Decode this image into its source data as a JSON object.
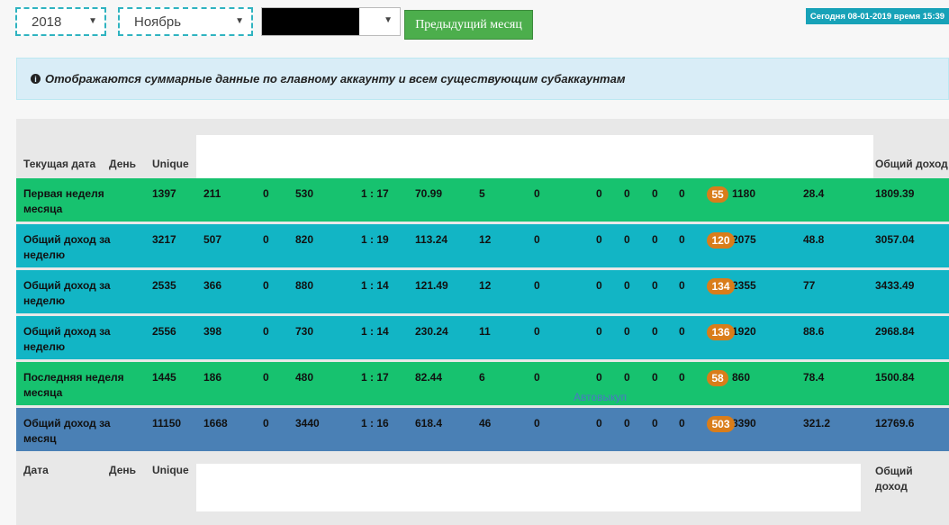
{
  "filters": {
    "year": "2018",
    "month": "Ноябрь",
    "account": ""
  },
  "prev_month_button": "Предыдущий месяц",
  "today": "Сегодня 08-01-2019 время 15:39",
  "notice": "Отображаются суммарные данные по главному аккаунту и всем существующим субаккаунтам",
  "table": {
    "header": {
      "date": "Текущая дата",
      "day": "День",
      "unique": "Unique",
      "total": "Общий доход"
    },
    "rows": [
      {
        "label": "Первая неделя месяца",
        "unique": "1397",
        "c1": "211",
        "c2": "0",
        "c3": "530",
        "ratio": "1 : 17",
        "c5": "70.99",
        "c6": "5",
        "c7": "0",
        "c8": "0",
        "c9": "0",
        "c10": "0",
        "c11": "0",
        "badge": "55",
        "c12": "1180",
        "c13": "28.4",
        "total": "1809.39",
        "color": "#17c26f"
      },
      {
        "label": "Общий доход за неделю",
        "unique": "3217",
        "c1": "507",
        "c2": "0",
        "c3": "820",
        "ratio": "1 : 19",
        "c5": "113.24",
        "c6": "12",
        "c7": "0",
        "c8": "0",
        "c9": "0",
        "c10": "0",
        "c11": "0",
        "badge": "120",
        "c12": "2075",
        "c13": "48.8",
        "total": "3057.04",
        "color": "#12b5c5"
      },
      {
        "label": "Общий доход за неделю",
        "unique": "2535",
        "c1": "366",
        "c2": "0",
        "c3": "880",
        "ratio": "1 : 14",
        "c5": "121.49",
        "c6": "12",
        "c7": "0",
        "c8": "0",
        "c9": "0",
        "c10": "0",
        "c11": "0",
        "badge": "134",
        "c12": "2355",
        "c13": "77",
        "total": "3433.49",
        "color": "#12b5c5"
      },
      {
        "label": "Общий доход за неделю",
        "unique": "2556",
        "c1": "398",
        "c2": "0",
        "c3": "730",
        "ratio": "1 : 14",
        "c5": "230.24",
        "c6": "11",
        "c7": "0",
        "c8": "0",
        "c9": "0",
        "c10": "0",
        "c11": "0",
        "badge": "136",
        "c12": "1920",
        "c13": "88.6",
        "total": "2968.84",
        "color": "#12b5c5"
      },
      {
        "label": "Последняя неделя месяца",
        "unique": "1445",
        "c1": "186",
        "c2": "0",
        "c3": "480",
        "ratio": "1 : 17",
        "c5": "82.44",
        "c6": "6",
        "c7": "0",
        "c8": "0",
        "c9": "0",
        "c10": "0",
        "c11": "0",
        "badge": "58",
        "c12": "860",
        "c13": "78.4",
        "total": "1500.84",
        "color": "#17c26f"
      },
      {
        "label": "Общий доход за месяц",
        "unique": "11150",
        "c1": "1668",
        "c2": "0",
        "c3": "3440",
        "ratio": "1 : 16",
        "c5": "618.4",
        "c6": "46",
        "c7": "0",
        "c8": "0",
        "c9": "0",
        "c10": "0",
        "c11": "0",
        "badge": "503",
        "c12": "8390",
        "c13": "321.2",
        "total": "12769.6",
        "color": "#4a80b5"
      }
    ],
    "footer": {
      "date": "Дата",
      "day": "День",
      "unique": "Unique",
      "total": "Общий доход"
    },
    "auto_link": "Автовыкуп"
  }
}
